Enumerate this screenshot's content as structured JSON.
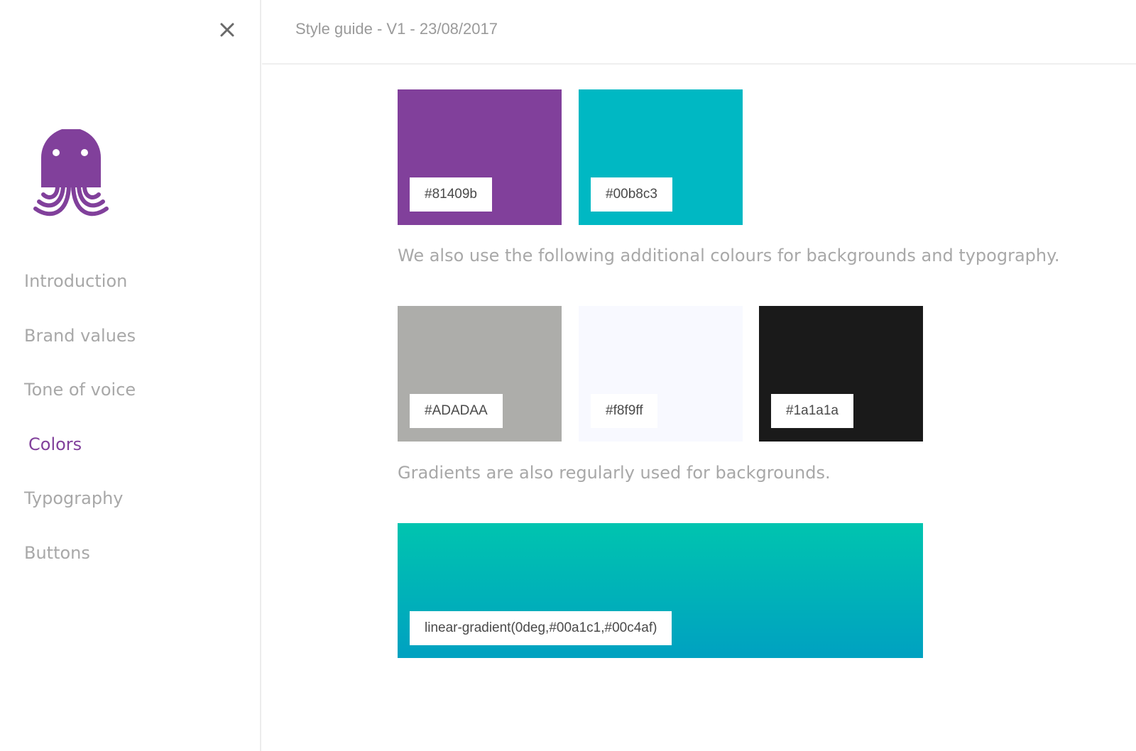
{
  "header": {
    "title": "Style guide - V1 - 23/08/2017"
  },
  "sidebar": {
    "logo_color": "#81409b",
    "items": [
      {
        "label": "Introduction",
        "active": false
      },
      {
        "label": "Brand values",
        "active": false
      },
      {
        "label": "Tone of voice",
        "active": false
      },
      {
        "label": "Colors",
        "active": true
      },
      {
        "label": "Typography",
        "active": false
      },
      {
        "label": "Buttons",
        "active": false
      }
    ]
  },
  "main": {
    "primary_colors": [
      {
        "hex": "#81409b",
        "label": "#81409b"
      },
      {
        "hex": "#00b8c3",
        "label": "#00b8c3"
      }
    ],
    "additional_text": "We also use the following additional colours for backgrounds and typography.",
    "additional_colors": [
      {
        "hex": "#ADADAA",
        "label": "#ADADAA"
      },
      {
        "hex": "#f8f9ff",
        "label": "#f8f9ff"
      },
      {
        "hex": "#1a1a1a",
        "label": "#1a1a1a"
      }
    ],
    "gradient_text": "Gradients are also regularly used for backgrounds.",
    "gradient": {
      "css": "linear-gradient(0deg,#00a1c1,#00c4af)",
      "label": "linear-gradient(0deg,#00a1c1,#00c4af)"
    }
  }
}
